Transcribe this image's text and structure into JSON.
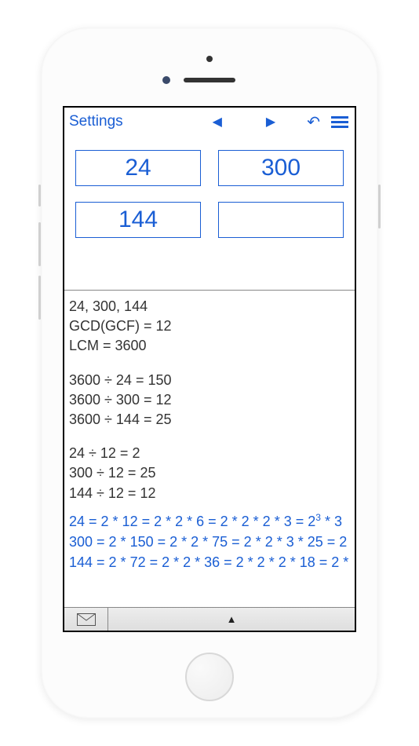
{
  "toolbar": {
    "settings_label": "Settings"
  },
  "inputs": {
    "field1": "24",
    "field2": "300",
    "field3": "144",
    "field4": ""
  },
  "results": {
    "header_line": "24, 300, 144",
    "gcd_line": "GCD(GCF) = 12",
    "lcm_line": "LCM = 3600",
    "lcm_div": [
      "3600 ÷ 24 = 150",
      "3600 ÷ 300 = 12",
      "3600 ÷ 144 = 25"
    ],
    "gcd_div": [
      "24 ÷ 12 = 2",
      "300 ÷ 12 = 25",
      "144 ÷ 12 = 12"
    ]
  },
  "factorization": {
    "f1_a": "24 = 2 * 12 = 2 * 2 * 6 = 2 * 2 * 2 * 3 = 2",
    "f1_b": " * 3",
    "f1_sup": "3",
    "f2": "300 = 2 * 150 = 2 * 2 * 75 = 2 * 2 * 3 * 25 = 2",
    "f3": "144 = 2 * 72 = 2 * 2 * 36 = 2 * 2 * 2 * 18 = 2 *"
  }
}
